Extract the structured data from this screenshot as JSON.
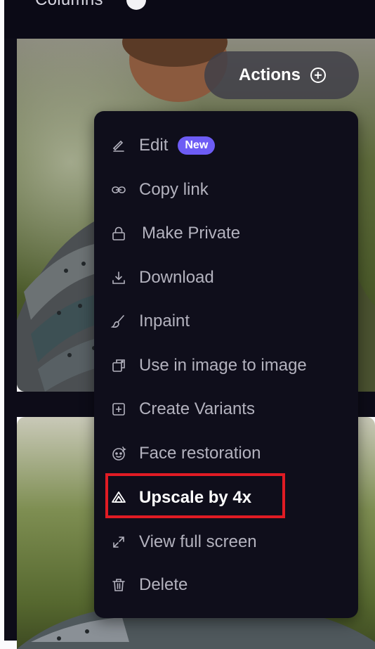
{
  "topbar": {
    "label": "Columns"
  },
  "actions_button": {
    "label": "Actions"
  },
  "menu": {
    "items": [
      {
        "label": "Edit",
        "icon": "pencil-icon",
        "badge": "New"
      },
      {
        "label": "Copy link",
        "icon": "link-icon"
      },
      {
        "label": "Make Private",
        "icon": "lock-icon"
      },
      {
        "label": "Download",
        "icon": "download-icon"
      },
      {
        "label": "Inpaint",
        "icon": "brush-icon"
      },
      {
        "label": "Use in image to image",
        "icon": "image-to-image-icon"
      },
      {
        "label": "Create Variants",
        "icon": "plus-square-icon"
      },
      {
        "label": "Face restoration",
        "icon": "face-restore-icon"
      },
      {
        "label": "Upscale by 4x",
        "icon": "upscale-icon",
        "highlighted": true
      },
      {
        "label": "View full screen",
        "icon": "expand-icon"
      },
      {
        "label": "Delete",
        "icon": "trash-icon"
      }
    ]
  },
  "colors": {
    "menu_background": "#0f0e1b",
    "menu_text": "#b3b2be",
    "badge": "#6d5cf5",
    "highlight_border": "#e01b24"
  }
}
